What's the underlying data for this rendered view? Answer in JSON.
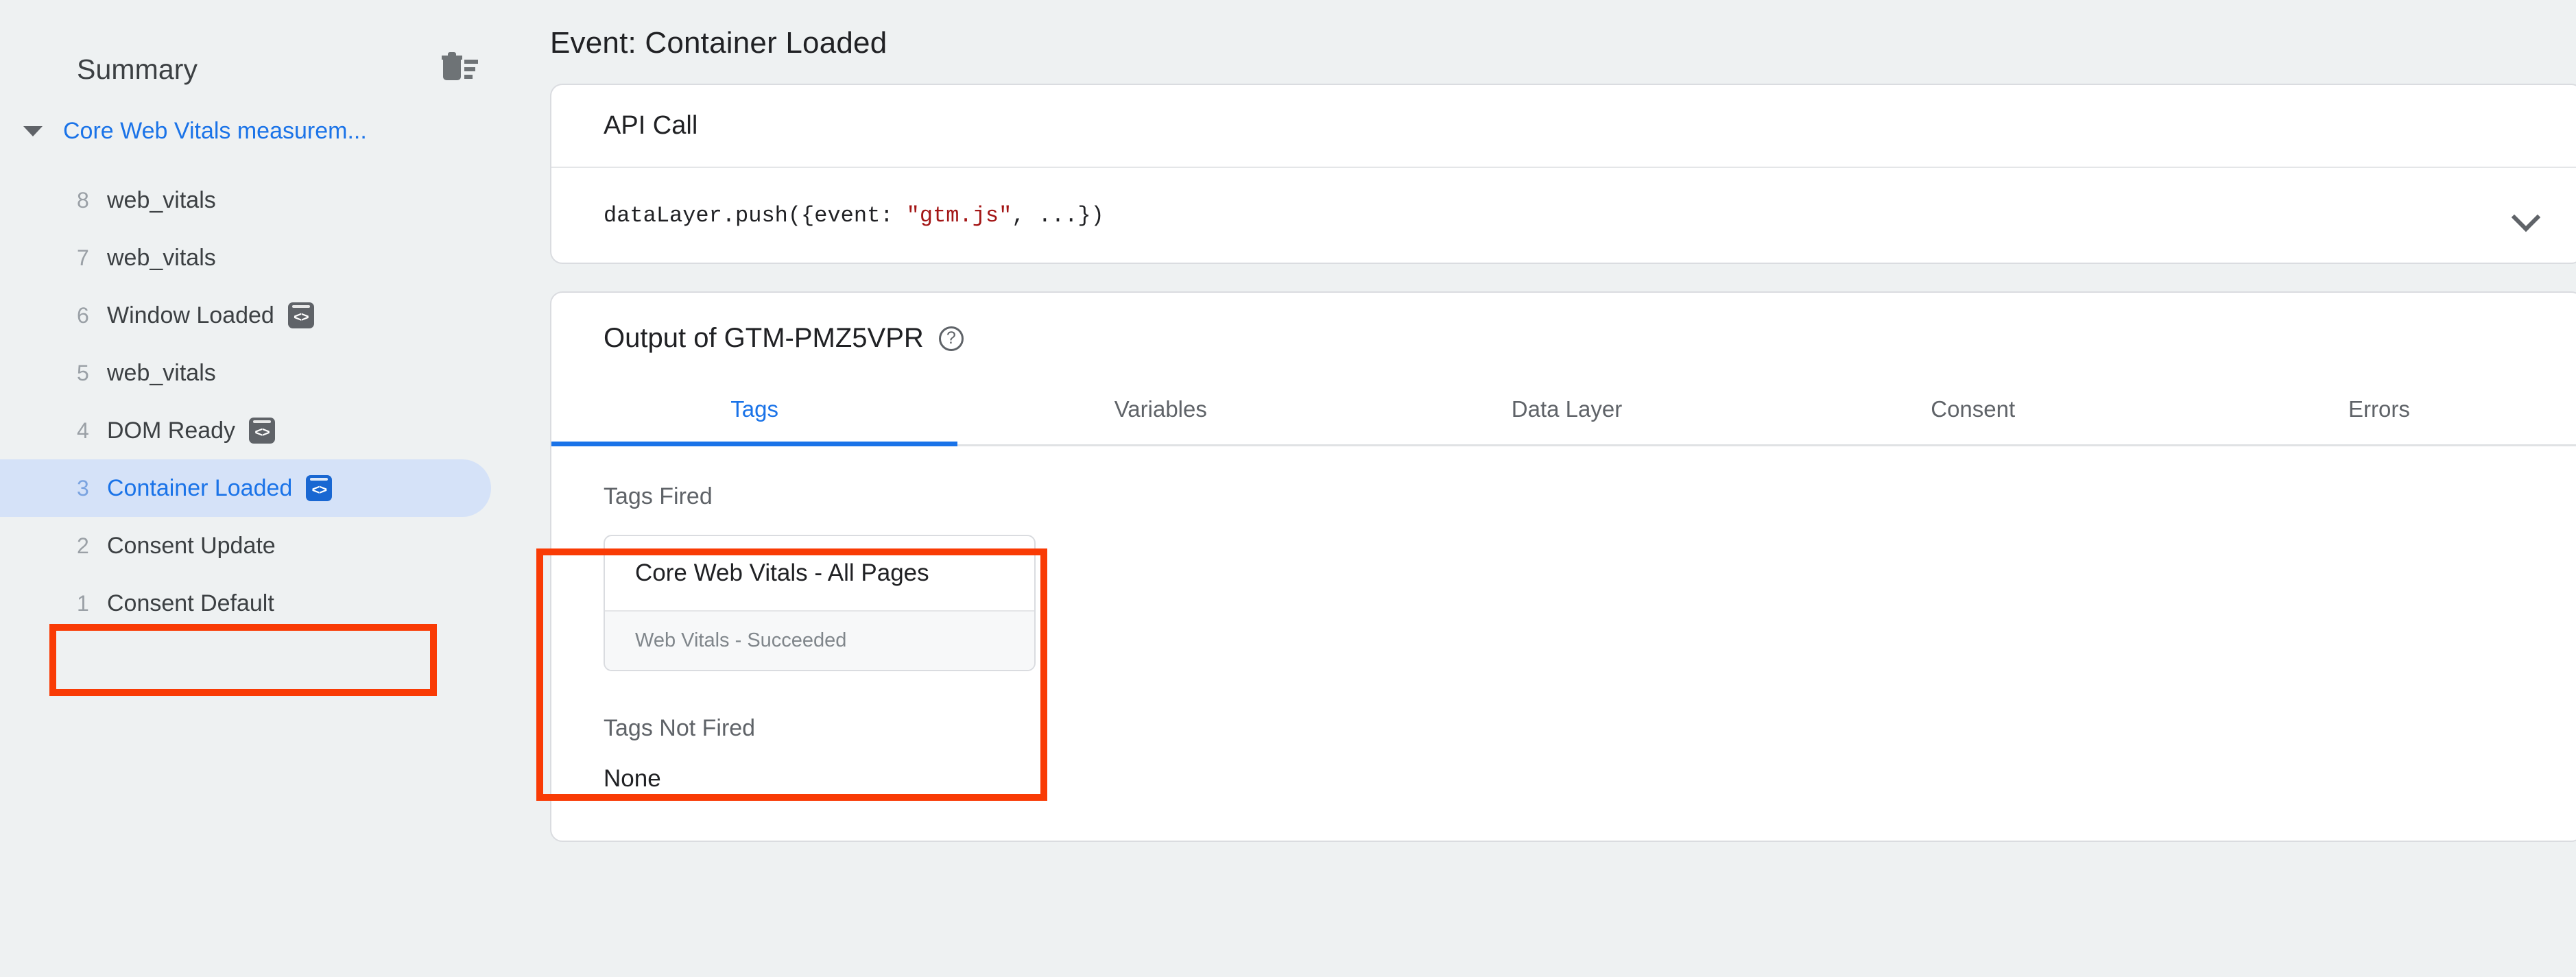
{
  "sidebar": {
    "title": "Summary",
    "clear_icon": "delete-sweep-icon",
    "group": {
      "label": "Core Web Vitals measurem...",
      "caret_icon": "caret-down-icon",
      "expanded": true
    },
    "events": [
      {
        "index": "8",
        "label": "web_vitals",
        "badge": false,
        "selected": false
      },
      {
        "index": "7",
        "label": "web_vitals",
        "badge": false,
        "selected": false
      },
      {
        "index": "6",
        "label": "Window Loaded",
        "badge": true,
        "selected": false
      },
      {
        "index": "5",
        "label": "web_vitals",
        "badge": false,
        "selected": false
      },
      {
        "index": "4",
        "label": "DOM Ready",
        "badge": true,
        "selected": false
      },
      {
        "index": "3",
        "label": "Container Loaded",
        "badge": true,
        "selected": true
      },
      {
        "index": "2",
        "label": "Consent Update",
        "badge": false,
        "selected": false
      },
      {
        "index": "1",
        "label": "Consent Default",
        "badge": false,
        "selected": false
      }
    ],
    "badge_glyph": "<>"
  },
  "main": {
    "page_title": "Event: Container Loaded",
    "api_card": {
      "heading": "API Call",
      "code_prefix": "dataLayer.push({event: ",
      "code_string": "\"gtm.js\"",
      "code_suffix": ", ...})",
      "expand_icon": "chevron-down-icon"
    },
    "output_card": {
      "heading": "Output of GTM-PMZ5VPR",
      "help_icon": "help-circle-icon",
      "help_glyph": "?",
      "tabs": [
        {
          "label": "Tags",
          "active": true
        },
        {
          "label": "Variables",
          "active": false
        },
        {
          "label": "Data Layer",
          "active": false
        },
        {
          "label": "Consent",
          "active": false
        },
        {
          "label": "Errors",
          "active": false
        }
      ],
      "tags_fired_title": "Tags Fired",
      "tags_fired": [
        {
          "name": "Core Web Vitals - All Pages",
          "status": "Web Vitals - Succeeded"
        }
      ],
      "tags_not_fired_title": "Tags Not Fired",
      "tags_not_fired_value": "None"
    }
  },
  "annotations": {
    "color": "#f93b05",
    "boxes": [
      {
        "name": "selected-event-highlight"
      },
      {
        "name": "tags-fired-highlight"
      }
    ]
  },
  "colors": {
    "accent_blue": "#1a73e8",
    "selected_pill": "#d5e2f8",
    "annotation_red": "#f93b05",
    "page_bg": "#eef1f2",
    "code_string": "#a31515"
  }
}
